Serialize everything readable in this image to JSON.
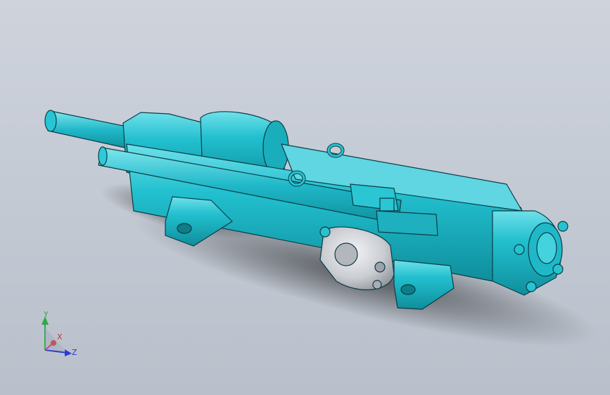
{
  "viewport": {
    "background_top": "#ced3dc",
    "background_bottom": "#b9c0cb"
  },
  "model": {
    "body_color": "#1fb8c8",
    "body_shade": "#12909f",
    "body_highlight": "#6fe0ea",
    "edge_color": "#0b3d45",
    "cover_color": "#c9ccd1"
  },
  "triad": {
    "x_label": "X",
    "y_label": "Y",
    "z_label": "Z",
    "x_color": "#d0302c",
    "y_color": "#2fa84a",
    "z_color": "#2a3ad0"
  }
}
